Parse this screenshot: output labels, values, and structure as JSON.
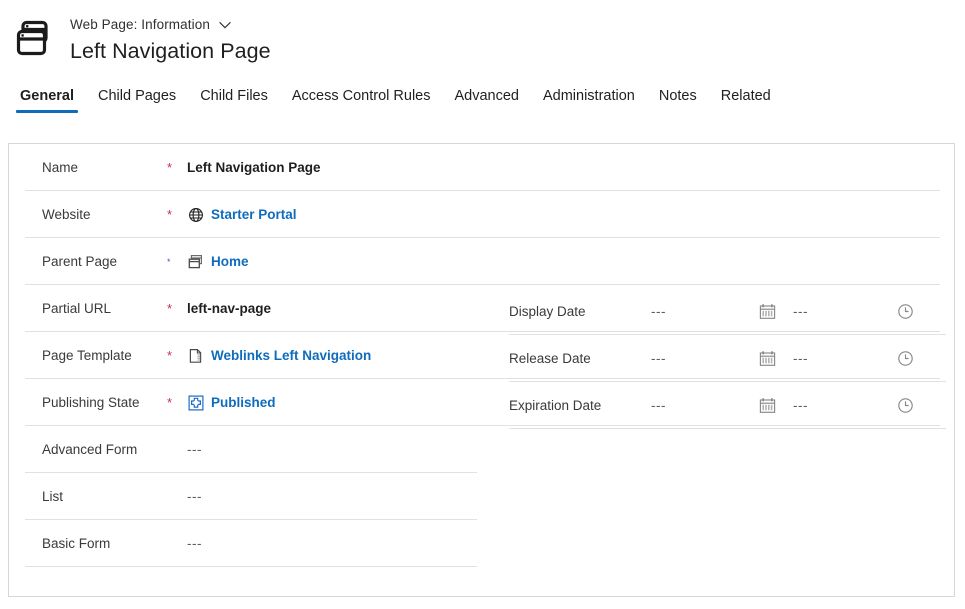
{
  "header": {
    "app_icon": "web-pages-icon",
    "entity_label": "Web Page: Information",
    "chevron_icon": "chevron-down-icon",
    "record_title": "Left Navigation Page"
  },
  "colors": {
    "accent": "#0f6cbd",
    "required": "#c4314b",
    "link": "#0f6cbd",
    "divider": "#e1e1e1",
    "border": "#d6d6d6",
    "label": "#3b3a39",
    "muted": "#605e5c"
  },
  "tabs": [
    {
      "label": "General",
      "active": true
    },
    {
      "label": "Child Pages",
      "active": false
    },
    {
      "label": "Child Files",
      "active": false
    },
    {
      "label": "Access Control Rules",
      "active": false
    },
    {
      "label": "Advanced",
      "active": false
    },
    {
      "label": "Administration",
      "active": false
    },
    {
      "label": "Notes",
      "active": false
    },
    {
      "label": "Related",
      "active": false
    }
  ],
  "form": {
    "left_fields": [
      {
        "label": "Name",
        "required": "*",
        "required_style": "red",
        "value": "Left Navigation Page",
        "value_style": "bold",
        "icon": null,
        "full_divider": true
      },
      {
        "label": "Website",
        "required": "*",
        "required_style": "red",
        "value": "Starter Portal",
        "value_style": "link",
        "icon": "globe-icon",
        "full_divider": true
      },
      {
        "label": "Parent Page",
        "required": "*",
        "required_style": "blue",
        "value": "Home",
        "value_style": "link",
        "icon": "web-pages-icon",
        "full_divider": true
      },
      {
        "label": "Partial URL",
        "required": "*",
        "required_style": "red",
        "value": "left-nav-page",
        "value_style": "bold",
        "icon": null,
        "full_divider": true
      },
      {
        "label": "Page Template",
        "required": "*",
        "required_style": "red",
        "value": "Weblinks Left Navigation",
        "value_style": "link",
        "icon": "page-template-icon",
        "full_divider": true
      },
      {
        "label": "Publishing State",
        "required": "*",
        "required_style": "red",
        "value": "Published",
        "value_style": "link",
        "icon": "publishing-state-icon",
        "full_divider": true
      },
      {
        "label": "Advanced Form",
        "required": "",
        "required_style": "none",
        "value": "---",
        "value_style": "empty",
        "icon": null,
        "full_divider": false
      },
      {
        "label": "List",
        "required": "",
        "required_style": "none",
        "value": "---",
        "value_style": "empty",
        "icon": null,
        "full_divider": false
      },
      {
        "label": "Basic Form",
        "required": "",
        "required_style": "none",
        "value": "---",
        "value_style": "empty",
        "icon": null,
        "full_divider": false
      }
    ],
    "right_fields": [
      {
        "label": "Display Date",
        "date_value": "---",
        "calendar_icon": "calendar-icon",
        "time_value": "---",
        "clock_icon": "clock-icon"
      },
      {
        "label": "Release Date",
        "date_value": "---",
        "calendar_icon": "calendar-icon",
        "time_value": "---",
        "clock_icon": "clock-icon"
      },
      {
        "label": "Expiration Date",
        "date_value": "---",
        "calendar_icon": "calendar-icon",
        "time_value": "---",
        "clock_icon": "clock-icon"
      }
    ]
  }
}
